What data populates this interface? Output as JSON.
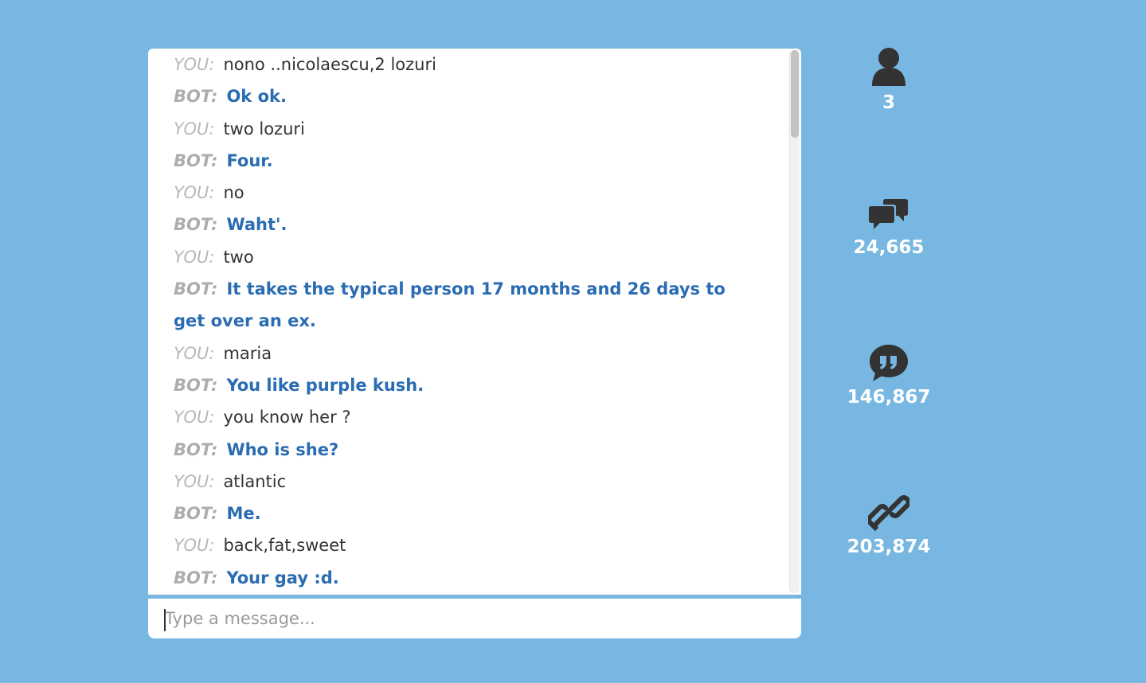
{
  "chat": {
    "messages": [
      {
        "speaker": "YOU:",
        "text": "nono ..nicolaescu,2 lozuri",
        "role": "you"
      },
      {
        "speaker": "BOT:",
        "text": "Ok ok.",
        "role": "bot"
      },
      {
        "speaker": "YOU:",
        "text": "two lozuri",
        "role": "you"
      },
      {
        "speaker": "BOT:",
        "text": "Four.",
        "role": "bot"
      },
      {
        "speaker": "YOU:",
        "text": "no",
        "role": "you"
      },
      {
        "speaker": "BOT:",
        "text": "Waht'.",
        "role": "bot"
      },
      {
        "speaker": "YOU:",
        "text": "two",
        "role": "you"
      },
      {
        "speaker": "BOT:",
        "text": "It takes the typical person 17 months and 26 days to get over an ex.",
        "role": "bot"
      },
      {
        "speaker": "YOU:",
        "text": "maria",
        "role": "you"
      },
      {
        "speaker": "BOT:",
        "text": "You like purple kush.",
        "role": "bot"
      },
      {
        "speaker": "YOU:",
        "text": "you know her ?",
        "role": "you"
      },
      {
        "speaker": "BOT:",
        "text": "Who is she?",
        "role": "bot"
      },
      {
        "speaker": "YOU:",
        "text": "atlantic",
        "role": "you"
      },
      {
        "speaker": "BOT:",
        "text": "Me.",
        "role": "bot"
      },
      {
        "speaker": "YOU:",
        "text": "back,fat,sweet",
        "role": "you"
      },
      {
        "speaker": "BOT:",
        "text": "Your gay :d.",
        "role": "bot"
      }
    ],
    "input_placeholder": "Type a message...",
    "input_value": ""
  },
  "stats": [
    {
      "icon": "user-icon",
      "value": "3"
    },
    {
      "icon": "chat-bubbles-icon",
      "value": "24,665"
    },
    {
      "icon": "quote-bubble-icon",
      "value": "146,867"
    },
    {
      "icon": "link-icon",
      "value": "203,874"
    }
  ],
  "colors": {
    "background": "#77b7e1",
    "bot_text": "#2a6cb2",
    "you_text": "#333333",
    "label": "#b8b8b8",
    "icon": "#333333"
  }
}
